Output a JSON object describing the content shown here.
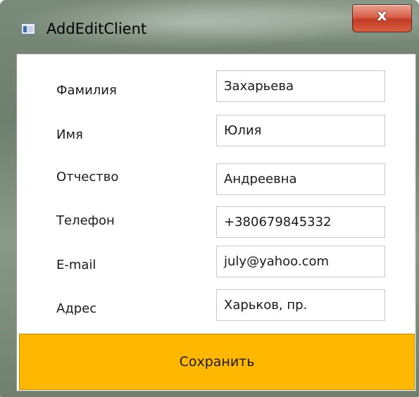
{
  "window": {
    "title": "AddEditClient",
    "close_glyph": "x"
  },
  "form": {
    "fields": [
      {
        "label": "Фамилия",
        "value": "Захарьева"
      },
      {
        "label": "Имя",
        "value": "Юлия"
      },
      {
        "label": "Отчество",
        "value": "Андреевна"
      },
      {
        "label": "Телефон",
        "value": "+380679845332"
      },
      {
        "label": "E-mail",
        "value": "july@yahoo.com"
      },
      {
        "label": "Адрес",
        "value": "Харьков, пр."
      }
    ]
  },
  "actions": {
    "save_label": "Сохранить"
  },
  "colors": {
    "accent": "#ffb700",
    "close_button": "#c23c23"
  }
}
